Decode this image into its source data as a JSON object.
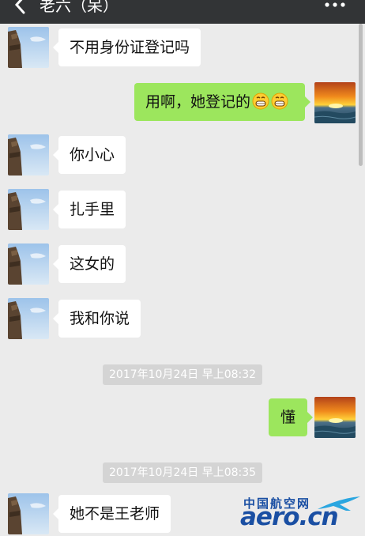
{
  "header": {
    "title": "老六（呆）",
    "back_icon": "chevron-left-icon",
    "more_icon": "more-dots-icon"
  },
  "messages": [
    {
      "type": "in",
      "text": "不用身份证登记吗"
    },
    {
      "type": "out",
      "text": "用啊，她登记的",
      "emoji": [
        "grin-emoji",
        "grin-emoji"
      ]
    },
    {
      "type": "in",
      "text": "你小心"
    },
    {
      "type": "in",
      "text": "扎手里"
    },
    {
      "type": "in",
      "text": "这女的"
    },
    {
      "type": "in",
      "text": "我和你说"
    },
    {
      "type": "time",
      "text": "2017年10月24日 早上08:32"
    },
    {
      "type": "out",
      "text": "懂"
    },
    {
      "type": "time",
      "text": "2017年10月24日 早上08:35"
    },
    {
      "type": "in",
      "text": "她不是王老师"
    }
  ],
  "watermark": {
    "cn": "中国航空网",
    "logo": "aero.cn"
  },
  "colors": {
    "header_bg": "#323436",
    "chat_bg": "#ebebeb",
    "outgoing_bubble": "#9ce65d",
    "incoming_bubble": "#ffffff",
    "timestamp_bg": "#d4d4d4"
  }
}
